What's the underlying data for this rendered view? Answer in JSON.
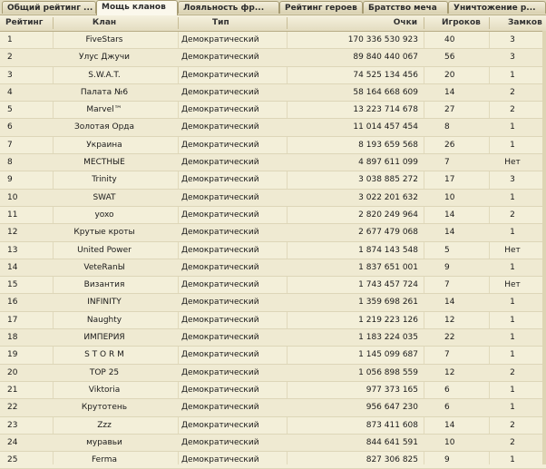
{
  "tabs": [
    {
      "label": "Общий рейтинг ...",
      "active": false
    },
    {
      "label": "Мощь кланов",
      "active": true
    },
    {
      "label": "Лояльность фр...",
      "active": false
    },
    {
      "label": "Рейтинг героев",
      "active": false
    },
    {
      "label": "Братство меча",
      "active": false
    },
    {
      "label": "Уничтожение р...",
      "active": false
    }
  ],
  "columns": {
    "rank": "Рейтинг",
    "clan": "Клан",
    "type": "Тип",
    "points": "Очки",
    "players": "Игроков",
    "castles": "Замков"
  },
  "rows": [
    {
      "rank": "1",
      "clan": "FiveStars",
      "type": "Демократический",
      "points": "170 336 530 923",
      "players": "40",
      "castles": "3"
    },
    {
      "rank": "2",
      "clan": "Улус Джучи",
      "type": "Демократический",
      "points": "89 840 440 067",
      "players": "56",
      "castles": "3"
    },
    {
      "rank": "3",
      "clan": "S.W.A.T.",
      "type": "Демократический",
      "points": "74 525 134 456",
      "players": "20",
      "castles": "1"
    },
    {
      "rank": "4",
      "clan": "Палата №6",
      "type": "Демократический",
      "points": "58 164 668 609",
      "players": "14",
      "castles": "2"
    },
    {
      "rank": "5",
      "clan": "Marvel™",
      "type": "Демократический",
      "points": "13 223 714 678",
      "players": "27",
      "castles": "2"
    },
    {
      "rank": "6",
      "clan": "Золотая Орда",
      "type": "Демократический",
      "points": "11 014 457 454",
      "players": "8",
      "castles": "1"
    },
    {
      "rank": "7",
      "clan": "Украина",
      "type": "Демократический",
      "points": "8 193 659 568",
      "players": "26",
      "castles": "1"
    },
    {
      "rank": "8",
      "clan": "МЕСТНЫЕ",
      "type": "Демократический",
      "points": "4 897 611 099",
      "players": "7",
      "castles": "Нет"
    },
    {
      "rank": "9",
      "clan": "Trinity",
      "type": "Демократический",
      "points": "3 038 885 272",
      "players": "17",
      "castles": "3"
    },
    {
      "rank": "10",
      "clan": "SWAT",
      "type": "Демократический",
      "points": "3 022 201 632",
      "players": "10",
      "castles": "1"
    },
    {
      "rank": "11",
      "clan": "yoxo",
      "type": "Демократический",
      "points": "2 820 249 964",
      "players": "14",
      "castles": "2"
    },
    {
      "rank": "12",
      "clan": "Крутые кроты",
      "type": "Демократический",
      "points": "2 677 479 068",
      "players": "14",
      "castles": "1"
    },
    {
      "rank": "13",
      "clan": "United Power",
      "type": "Демократический",
      "points": "1 874 143 548",
      "players": "5",
      "castles": "Нет"
    },
    {
      "rank": "14",
      "clan": "VeteRanЫ",
      "type": "Демократический",
      "points": "1 837 651 001",
      "players": "9",
      "castles": "1"
    },
    {
      "rank": "15",
      "clan": "Византия",
      "type": "Демократический",
      "points": "1 743 457 724",
      "players": "7",
      "castles": "Нет"
    },
    {
      "rank": "16",
      "clan": "INFINITY",
      "type": "Демократический",
      "points": "1 359 698 261",
      "players": "14",
      "castles": "1"
    },
    {
      "rank": "17",
      "clan": "Naughty",
      "type": "Демократический",
      "points": "1 219 223 126",
      "players": "12",
      "castles": "1"
    },
    {
      "rank": "18",
      "clan": "ИМПЕРИЯ",
      "type": "Демократический",
      "points": "1 183 224 035",
      "players": "22",
      "castles": "1"
    },
    {
      "rank": "19",
      "clan": "S T O R M",
      "type": "Демократический",
      "points": "1 145 099 687",
      "players": "7",
      "castles": "1"
    },
    {
      "rank": "20",
      "clan": "TOP 25",
      "type": "Демократический",
      "points": "1 056 898 559",
      "players": "12",
      "castles": "2"
    },
    {
      "rank": "21",
      "clan": "Viktoria",
      "type": "Демократический",
      "points": "977 373 165",
      "players": "6",
      "castles": "1"
    },
    {
      "rank": "22",
      "clan": "Крутотень",
      "type": "Демократический",
      "points": "956 647 230",
      "players": "6",
      "castles": "1"
    },
    {
      "rank": "23",
      "clan": "Zzz",
      "type": "Демократический",
      "points": "873 411 608",
      "players": "14",
      "castles": "2"
    },
    {
      "rank": "24",
      "clan": "муравьи",
      "type": "Демократический",
      "points": "844 641 591",
      "players": "10",
      "castles": "2"
    },
    {
      "rank": "25",
      "clan": "Ferma",
      "type": "Демократический",
      "points": "827 306 825",
      "players": "9",
      "castles": "1"
    }
  ]
}
